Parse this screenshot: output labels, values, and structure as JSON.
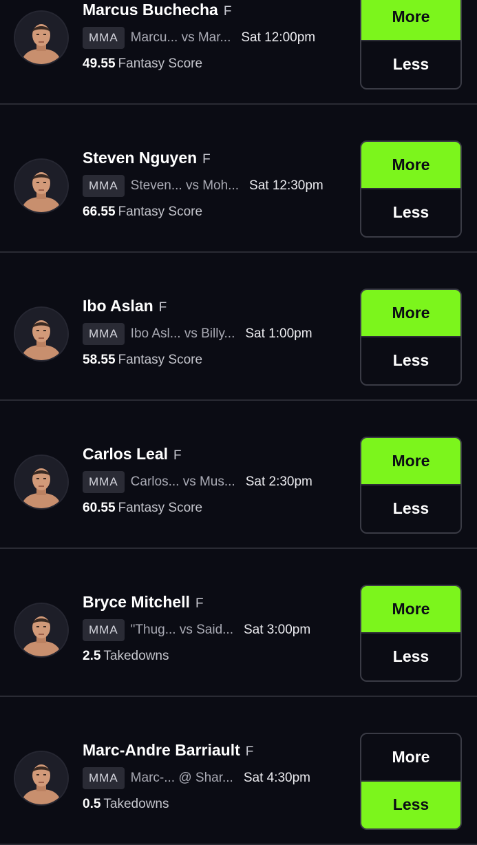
{
  "accent_color": "#7cf51c",
  "players": [
    {
      "name": "Marcus Buchecha",
      "position": "F",
      "league": "MMA",
      "matchup": "Marcu... vs Mar...",
      "time": "Sat 12:00pm",
      "line": "49.55",
      "stat": "Fantasy Score",
      "more_label": "More",
      "less_label": "Less",
      "selected": "more",
      "avatar_icon": "player-headshot"
    },
    {
      "name": "Steven Nguyen",
      "position": "F",
      "league": "MMA",
      "matchup": "Steven... vs Moh...",
      "time": "Sat 12:30pm",
      "line": "66.55",
      "stat": "Fantasy Score",
      "more_label": "More",
      "less_label": "Less",
      "selected": "more",
      "avatar_icon": "player-headshot"
    },
    {
      "name": "Ibo Aslan",
      "position": "F",
      "league": "MMA",
      "matchup": "Ibo Asl... vs Billy...",
      "time": "Sat 1:00pm",
      "line": "58.55",
      "stat": "Fantasy Score",
      "more_label": "More",
      "less_label": "Less",
      "selected": "more",
      "avatar_icon": "player-headshot"
    },
    {
      "name": "Carlos Leal",
      "position": "F",
      "league": "MMA",
      "matchup": "Carlos... vs Mus...",
      "time": "Sat 2:30pm",
      "line": "60.55",
      "stat": "Fantasy Score",
      "more_label": "More",
      "less_label": "Less",
      "selected": "more",
      "avatar_icon": "player-headshot"
    },
    {
      "name": "Bryce Mitchell",
      "position": "F",
      "league": "MMA",
      "matchup": "\"Thug... vs Said...",
      "time": "Sat 3:00pm",
      "line": "2.5",
      "stat": "Takedowns",
      "more_label": "More",
      "less_label": "Less",
      "selected": "more",
      "avatar_icon": "player-headshot"
    },
    {
      "name": "Marc-Andre Barriault",
      "position": "F",
      "league": "MMA",
      "matchup": "Marc-... @ Shar...",
      "time": "Sat 4:30pm",
      "line": "0.5",
      "stat": "Takedowns",
      "more_label": "More",
      "less_label": "Less",
      "selected": "less",
      "avatar_icon": "player-headshot"
    }
  ]
}
